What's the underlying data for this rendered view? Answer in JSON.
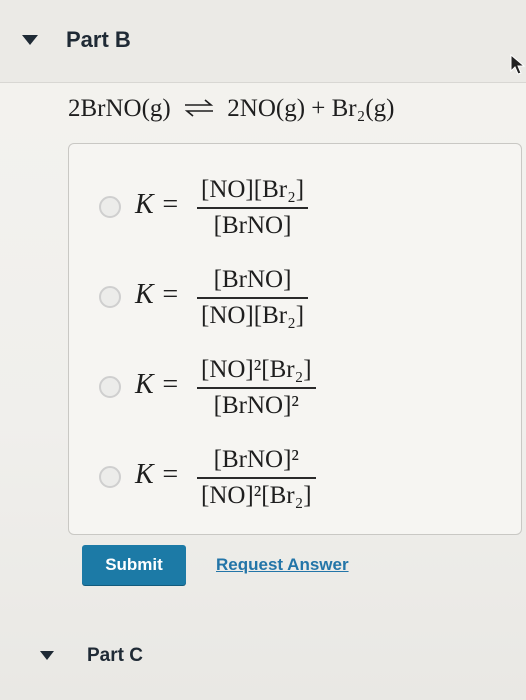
{
  "part_b": {
    "title": "Part B"
  },
  "equation": {
    "reactant": "2BrNO(g)",
    "arrow": "⇌",
    "products": "2NO(g) + Br₂(g)"
  },
  "options": [
    {
      "k": "K =",
      "numerator": "[NO][Br₂]",
      "denominator": "[BrNO]"
    },
    {
      "k": "K =",
      "numerator": "[BrNO]",
      "denominator": "[NO][Br₂]"
    },
    {
      "k": "K =",
      "numerator": "[NO]²[Br₂]",
      "denominator": "[BrNO]²"
    },
    {
      "k": "K =",
      "numerator": "[BrNO]²",
      "denominator": "[NO]²[Br₂]"
    }
  ],
  "buttons": {
    "submit": "Submit",
    "request_answer": "Request Answer"
  },
  "part_c": {
    "title": "Part C"
  }
}
